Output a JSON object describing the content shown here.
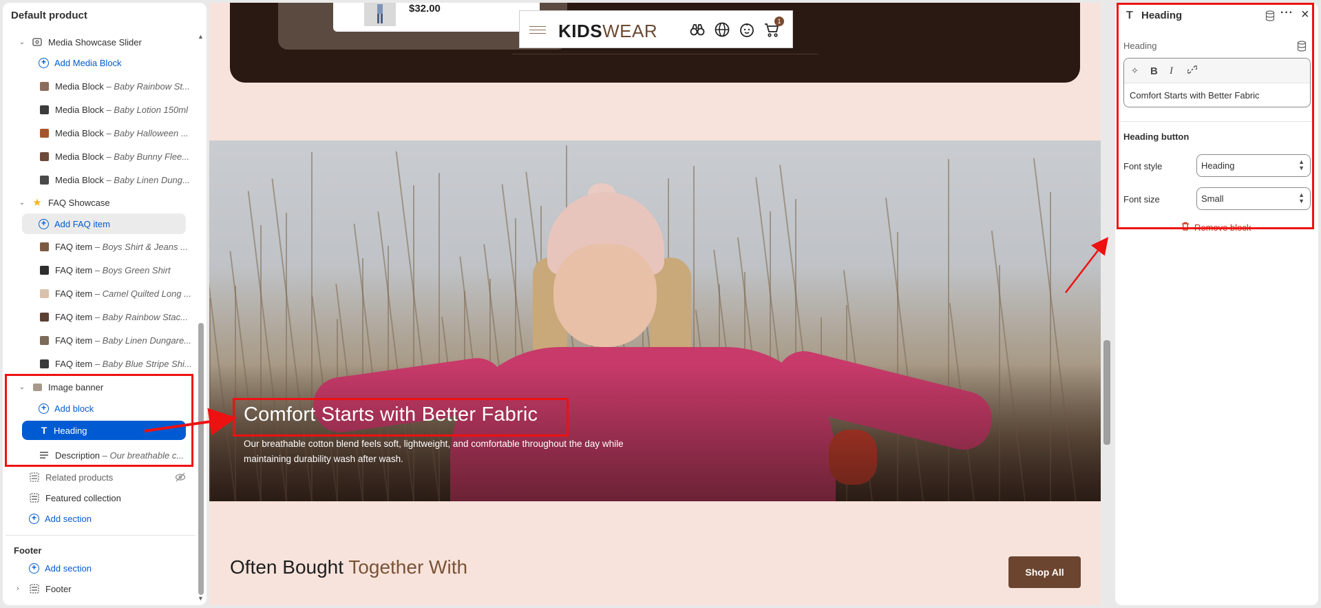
{
  "sidebar": {
    "title": "Default product",
    "media_section": {
      "label": "Media Showcase Slider",
      "add_label": "Add Media Block"
    },
    "media_blocks": [
      {
        "label": "Media Block",
        "detail": "– Baby Rainbow St...",
        "color": "#8a6d5c"
      },
      {
        "label": "Media Block",
        "detail": "– Baby Lotion 150ml",
        "color": "#3b3b3b"
      },
      {
        "label": "Media Block",
        "detail": "– Baby Halloween ...",
        "color": "#a5552d"
      },
      {
        "label": "Media Block",
        "detail": "– Baby Bunny Flee...",
        "color": "#6d4b3b"
      },
      {
        "label": "Media Block",
        "detail": "– Baby Linen Dung...",
        "color": "#4a4a4a"
      }
    ],
    "faq_section": {
      "label": "FAQ Showcase",
      "add_label": "Add FAQ item"
    },
    "faq_items": [
      {
        "label": "FAQ item",
        "detail": "– Boys Shirt & Jeans ...",
        "color": "#7b5a44"
      },
      {
        "label": "FAQ item",
        "detail": "– Boys Green Shirt",
        "color": "#2d2d2d"
      },
      {
        "label": "FAQ item",
        "detail": "– Camel Quilted Long ...",
        "color": "#d9c2ac"
      },
      {
        "label": "FAQ item",
        "detail": "– Baby Rainbow Stac...",
        "color": "#5a4032"
      },
      {
        "label": "FAQ item",
        "detail": "– Baby Linen Dungare...",
        "color": "#7c6a5a"
      },
      {
        "label": "FAQ item",
        "detail": "– Baby Blue Stripe Shi...",
        "color": "#3a3a3a"
      }
    ],
    "image_banner": {
      "label": "Image banner",
      "add_label": "Add block"
    },
    "heading_item": {
      "label": "Heading"
    },
    "description_item": {
      "label": "Description",
      "detail": "– Our breathable c..."
    },
    "related_products": "Related products",
    "featured_collection": "Featured collection",
    "add_section": "Add section",
    "footer_title": "Footer",
    "footer_add_section": "Add section",
    "footer_item": "Footer"
  },
  "preview": {
    "product_price": "$32.00",
    "logo_bold": "KIDS",
    "logo_light": "WEAR",
    "cart_count": "1",
    "banner_heading": "Comfort Starts with Better Fabric",
    "banner_description": "Our breathable cotton blend feels soft, lightweight, and comfortable throughout the day while maintaining durability wash after wash.",
    "section_title_main": "Often Bought",
    "section_title_accent": "Together With",
    "shop_all": "Shop All"
  },
  "panel": {
    "title": "Heading",
    "field_label": "Heading",
    "heading_value": "Comfort Starts with Better Fabric",
    "section_title": "Heading button",
    "font_style_label": "Font style",
    "font_style_value": "Heading",
    "font_size_label": "Font size",
    "font_size_value": "Small",
    "remove_label": "Remove block"
  },
  "colors": {
    "accent_blue": "#005bd3",
    "annotation_red": "#ee1111",
    "brand_brown": "#6b4530",
    "preview_bg": "#f7e3dc"
  }
}
